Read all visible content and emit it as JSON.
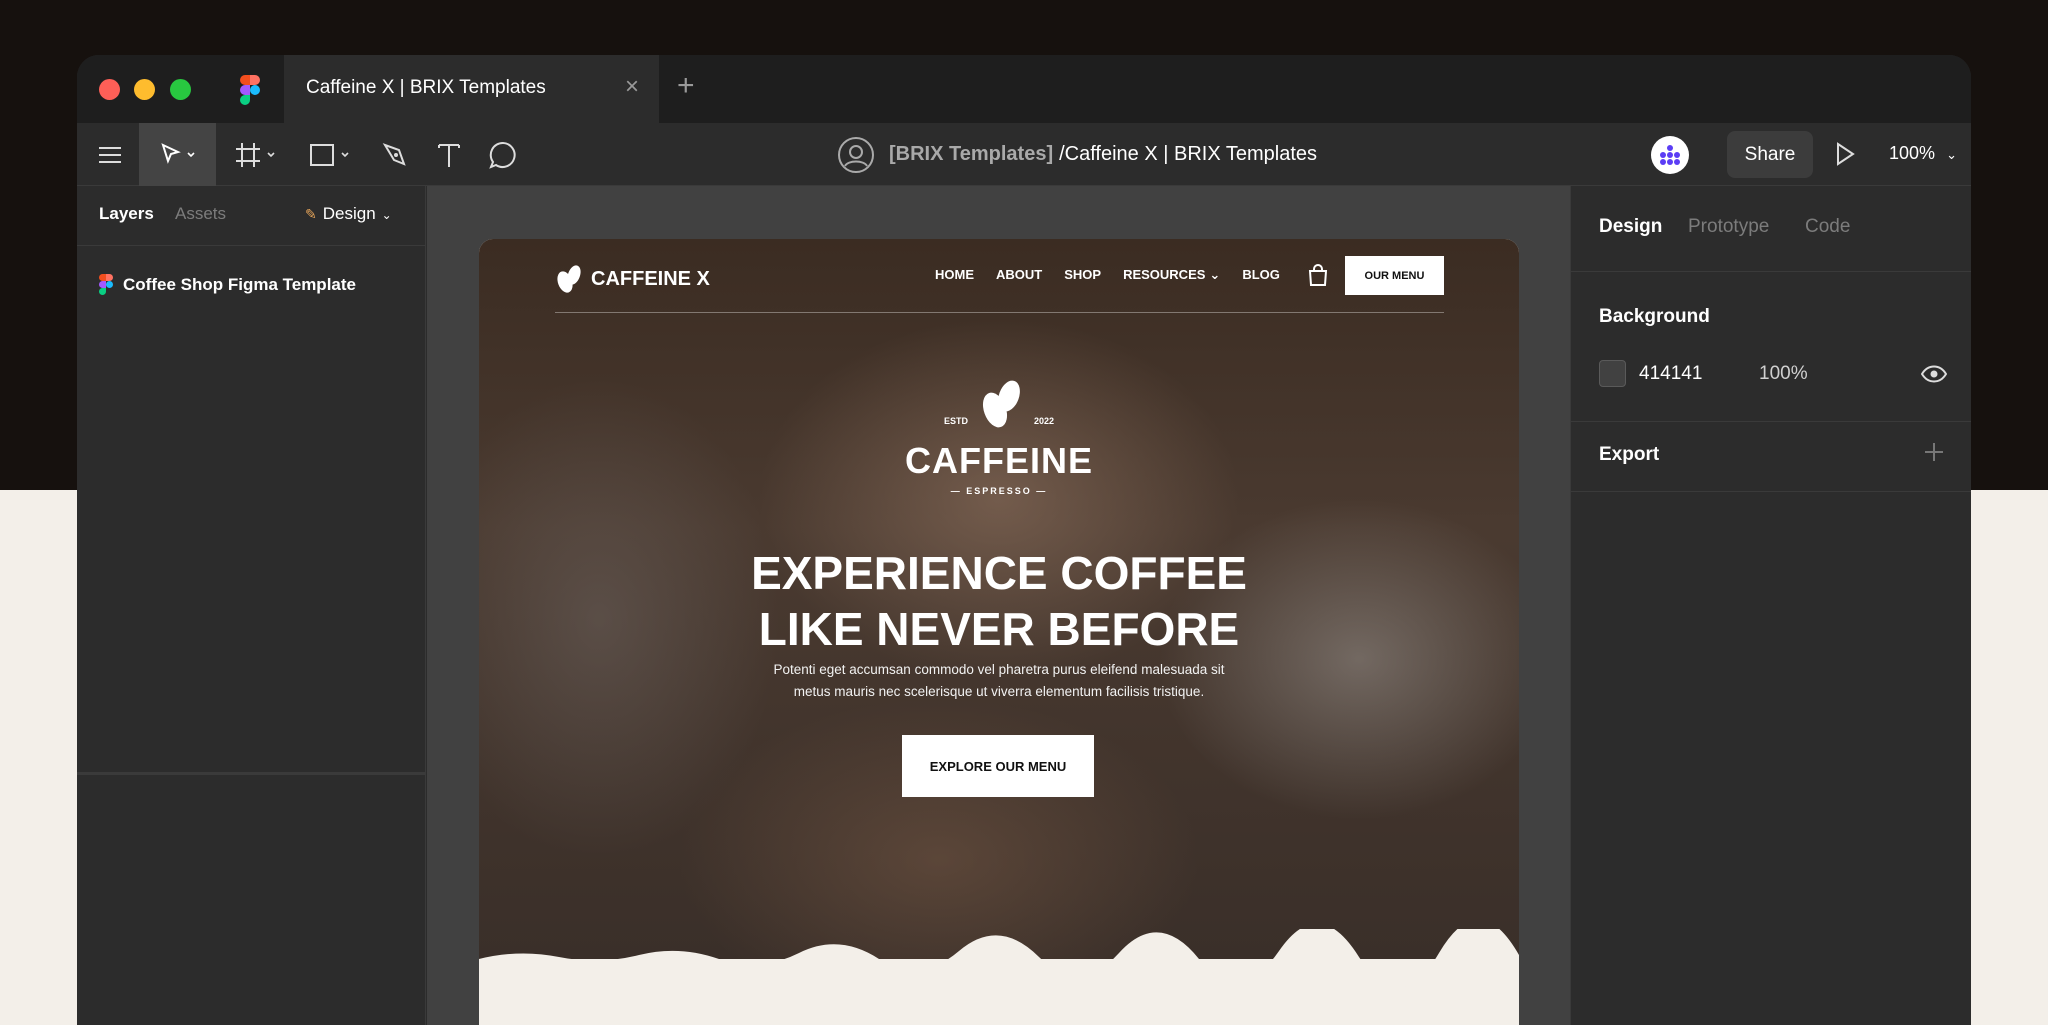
{
  "tab": {
    "title": "Caffeine X | BRIX Templates"
  },
  "toolbar": {
    "team": "[BRIX Templates]",
    "file": "/Caffeine X | BRIX Templates",
    "share_label": "Share",
    "zoom": "100%"
  },
  "left_panel": {
    "tabs": {
      "layers": "Layers",
      "assets": "Assets",
      "design": "Design"
    },
    "layers": [
      {
        "label": "Coffee Shop Figma Template"
      }
    ]
  },
  "site": {
    "brand": "CAFFEINE X",
    "nav": [
      "HOME",
      "ABOUT",
      "SHOP",
      "RESOURCES",
      "BLOG"
    ],
    "cta_nav": "OUR MENU",
    "badge": {
      "estd": "ESTD",
      "year": "2022",
      "name": "CAFFEINE",
      "sub": "ESPRESSO"
    },
    "headline_line1": "EXPERIENCE COFFEE",
    "headline_line2": "LIKE NEVER BEFORE",
    "copy_line1": "Potenti eget accumsan commodo vel pharetra purus eleifend malesuada sit",
    "copy_line2": "metus mauris nec scelerisque ut viverra elementum facilisis tristique.",
    "cta_hero": "EXPLORE OUR MENU"
  },
  "right_panel": {
    "tabs": {
      "design": "Design",
      "prototype": "Prototype",
      "code": "Code"
    },
    "background": {
      "heading": "Background",
      "hex": "414141",
      "opacity": "100%"
    },
    "export": {
      "heading": "Export"
    }
  },
  "colors": {
    "canvas": "#414141",
    "panel": "#2c2c2c",
    "titlebar": "#1e1e1e",
    "page_bg": "#f3efe9",
    "top_bg": "#16110e"
  }
}
